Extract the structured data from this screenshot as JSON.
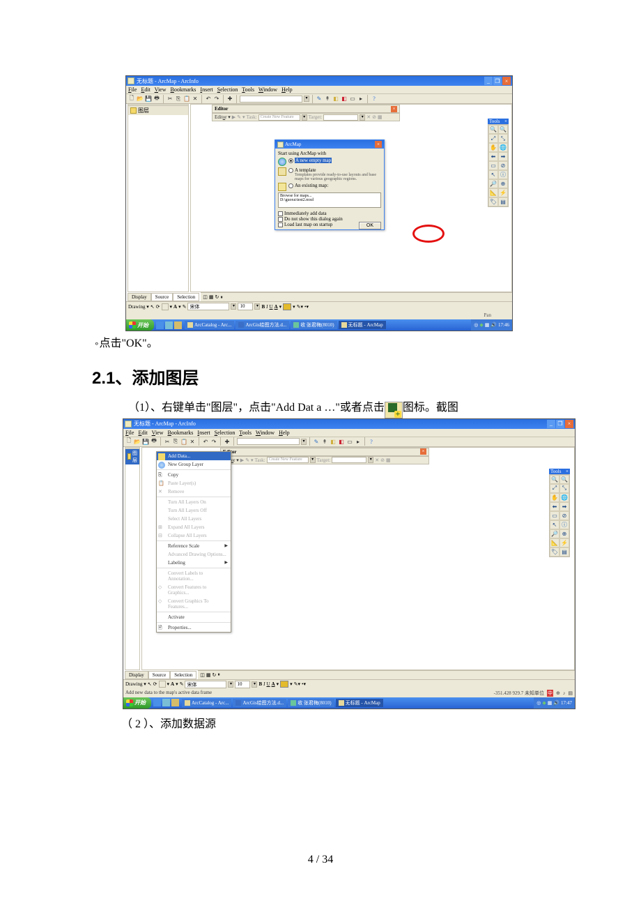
{
  "page_number": "4 / 34",
  "doc": {
    "line_click_ok": "点击\"OK\"。",
    "heading": "2.1、添加图层",
    "step1_prefix": "（1）、右键单击\"图层\"，点击\"Add Dat a …\"或者点击",
    "step1_suffix": "图标。截图",
    "step2": "（ 2 ）、添加数据源"
  },
  "screenshot1": {
    "title": "无标题 - ArcMap - ArcInfo",
    "menus": [
      "File",
      "Edit",
      "View",
      "Bookmarks",
      "Insert",
      "Selection",
      "Tools",
      "Window",
      "Help"
    ],
    "side_label": "图层",
    "editor": {
      "label": "Editor",
      "task": "Task:",
      "task_value": "Create New Feature",
      "target": "Target:"
    },
    "dialog": {
      "title": "ArcMap",
      "subtitle": "Start using ArcMap with",
      "opt_new": "A new empty map",
      "opt_template": "A template",
      "template_desc": "Templates provide ready-to-use layouts and base maps for various geographic regions.",
      "opt_existing": "An existing map:",
      "existing_line1": "Browse for maps...",
      "existing_line2": "D:\\guoxu\\test2.mxd",
      "chk1": "Immediately add data",
      "chk2": "Do not show this dialog again",
      "chk3": "Load last map on startup",
      "ok": "OK"
    },
    "tools_header": "Tools",
    "tabs": [
      "Display",
      "Source",
      "Selection"
    ],
    "drawing_label": "Drawing",
    "font_name": "宋体",
    "font_size": "10",
    "status_label": "Pan",
    "taskbar": {
      "start": "开始",
      "items": [
        "ArcCatalog - Arc...",
        "ArcGis绘图方法.d...",
        "收 张君梅(8010)",
        "无标题 - ArcMap"
      ],
      "time": "17:46"
    }
  },
  "screenshot2": {
    "title": "无标题 - ArcMap - ArcInfo",
    "menus": [
      "File",
      "Edit",
      "View",
      "Bookmarks",
      "Insert",
      "Selection",
      "Tools",
      "Window",
      "Help"
    ],
    "side_highlight": "图层",
    "editor": {
      "label": "Editor",
      "task": "Task:",
      "task_value": "Create New Feature",
      "target": "Target:"
    },
    "context": {
      "add_data": "Add Data...",
      "new_group": "New Group Layer",
      "copy": "Copy",
      "paste": "Paste Layer(s)",
      "remove": "Remove",
      "turn_on": "Turn All Layers On",
      "turn_off": "Turn All Layers Off",
      "select_all": "Select All Layers",
      "expand_all": "Expand All Layers",
      "collapse_all": "Collapse All Layers",
      "ref_scale": "Reference Scale",
      "adv_draw": "Advanced Drawing Options...",
      "labeling": "Labeling",
      "conv_lbl": "Convert Labels to Annotation...",
      "conv_feat": "Convert Features to Graphics...",
      "conv_gfx": "Convert Graphics To Features...",
      "activate": "Activate",
      "properties": "Properties..."
    },
    "tools_header": "Tools",
    "tabs": [
      "Display",
      "Source",
      "Selection"
    ],
    "drawing_label": "Drawing",
    "font_name": "宋体",
    "font_size": "10",
    "statusbar": "Add new data to the map's active data frame",
    "coords": "-351.428  929.7 未知单位",
    "taskbar": {
      "start": "开始",
      "items": [
        "ArcCatalog - Arc...",
        "ArcGis绘图方法.d...",
        "收 张君梅(8010)",
        "无标题 - ArcMap"
      ],
      "time": "17:47"
    }
  }
}
